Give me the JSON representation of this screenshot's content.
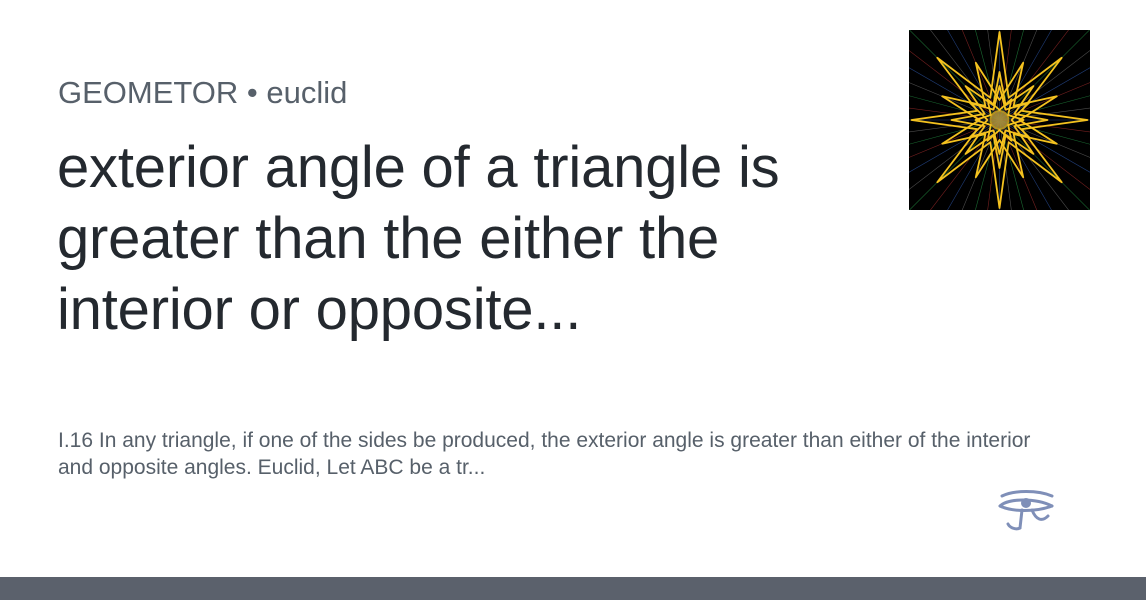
{
  "header": {
    "owner": "GEOMETOR",
    "separator": "•",
    "repo": "euclid"
  },
  "title": "exterior angle of a triangle is greater than the either the interior or opposite...",
  "description": "I.16 In any triangle, if one of the sides be produced, the exterior angle is greater than either of the interior and opposite angles. Euclid, Let ABC be a tr...",
  "images": {
    "avatar_icon": "geometric-star-avatar",
    "logo_icon": "eye-of-horus-icon"
  },
  "colors": {
    "title": "#24292f",
    "muted_text": "#57606a",
    "footer_bar": "#5b616c",
    "star": "#f4c21f",
    "logo": "#7f8fb8"
  }
}
